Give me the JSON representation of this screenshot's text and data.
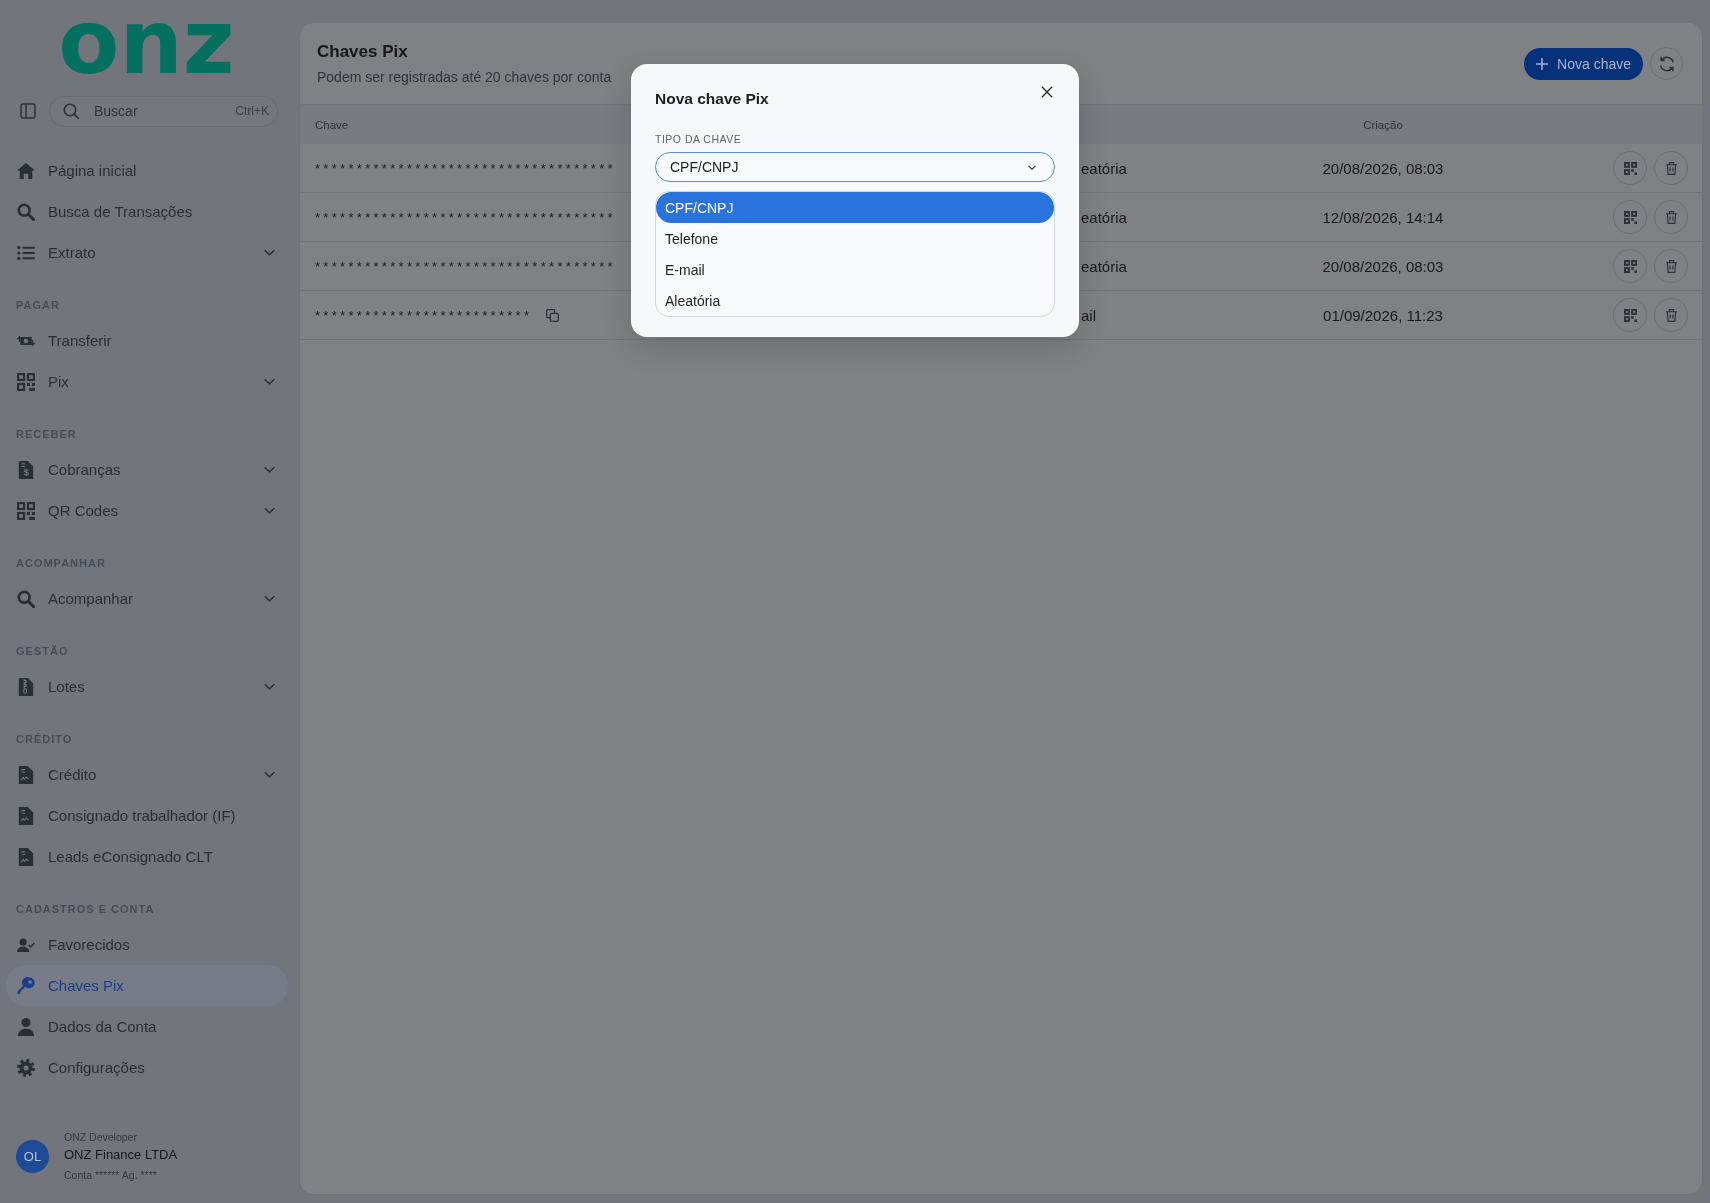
{
  "sidebar": {
    "logo": "onz",
    "search": {
      "placeholder": "Buscar",
      "shortcut": "Ctrl+K"
    },
    "sections": [
      {
        "items": [
          {
            "label": "Página inicial",
            "kind": "home",
            "expandable": false,
            "selected": false
          },
          {
            "label": "Busca de Transações",
            "kind": "search",
            "expandable": false,
            "selected": false
          },
          {
            "label": "Extrato",
            "kind": "list",
            "expandable": true,
            "selected": false
          }
        ]
      },
      {
        "title": "PAGAR",
        "items": [
          {
            "label": "Transferir",
            "kind": "transfer",
            "expandable": false,
            "selected": false
          },
          {
            "label": "Pix",
            "kind": "qr",
            "expandable": true,
            "selected": false
          }
        ]
      },
      {
        "title": "RECEBER",
        "items": [
          {
            "label": "Cobranças",
            "kind": "invoice",
            "expandable": true,
            "selected": false
          },
          {
            "label": "QR Codes",
            "kind": "qr",
            "expandable": true,
            "selected": false
          }
        ]
      },
      {
        "title": "ACOMPANHAR",
        "items": [
          {
            "label": "Acompanhar",
            "kind": "search",
            "expandable": true,
            "selected": false
          }
        ]
      },
      {
        "title": "GESTÃO",
        "items": [
          {
            "label": "Lotes",
            "kind": "archive",
            "expandable": true,
            "selected": false
          }
        ]
      },
      {
        "title": "CRÉDITO",
        "items": [
          {
            "label": "Crédito",
            "kind": "contract",
            "expandable": true,
            "selected": false
          },
          {
            "label": "Consignado trabalhador (IF)",
            "kind": "contract",
            "expandable": false,
            "selected": false
          },
          {
            "label": "Leads eConsignado CLT",
            "kind": "contract",
            "expandable": false,
            "selected": false
          }
        ]
      },
      {
        "title": "CADASTROS E CONTA",
        "items": [
          {
            "label": "Favorecidos",
            "kind": "contacts",
            "expandable": false,
            "selected": false
          },
          {
            "label": "Chaves Pix",
            "kind": "key",
            "expandable": false,
            "selected": true
          },
          {
            "label": "Dados da Conta",
            "kind": "user",
            "expandable": false,
            "selected": false
          },
          {
            "label": "Configurações",
            "kind": "settings",
            "expandable": false,
            "selected": false
          }
        ]
      }
    ],
    "user": {
      "initials": "OL",
      "role": "ONZ Developer",
      "company": "ONZ Finance LTDA",
      "account": "Conta ****** Ag. ****"
    }
  },
  "page": {
    "title": "Chaves Pix",
    "subtitle": "Podem ser registradas até 20 chaves por conta",
    "new_button": "Nova chave"
  },
  "table": {
    "columns": {
      "key": "Chave",
      "created": "Criação"
    },
    "rows": [
      {
        "key": "************************************",
        "copyable": false,
        "column_2": "eatória",
        "created": "20/08/2026, 08:03"
      },
      {
        "key": "************************************",
        "copyable": false,
        "column_2": "eatória",
        "created": "12/08/2026, 14:14"
      },
      {
        "key": "************************************",
        "copyable": false,
        "column_2": "eatória",
        "created": "20/08/2026, 08:03"
      },
      {
        "key": "**************************",
        "copyable": true,
        "column_2": "ail",
        "created": "01/09/2026, 11:23"
      }
    ]
  },
  "modal": {
    "title": "Nova chave Pix",
    "field_label": "TIPO DA CHAVE",
    "value": "CPF/CNPJ",
    "options": [
      {
        "label": "CPF/CNPJ",
        "selected": true
      },
      {
        "label": "Telefone",
        "selected": false
      },
      {
        "label": "E-mail",
        "selected": false
      },
      {
        "label": "Aleatória",
        "selected": false
      }
    ]
  }
}
